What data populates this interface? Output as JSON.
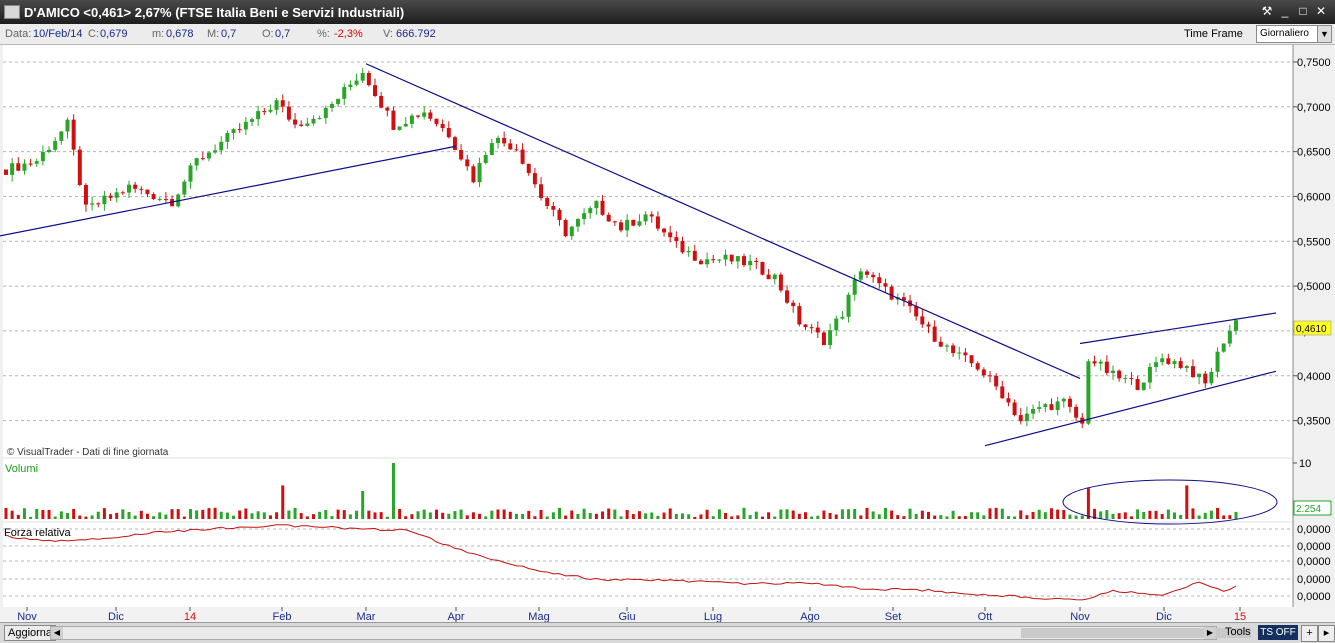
{
  "window": {
    "title": "D'AMICO <0,461> 2,67%  (FTSE Italia Beni e Servizi Industriali)",
    "buttons": {
      "tools": "⚒",
      "minimize": "_",
      "maximize": "□",
      "close": "✕"
    }
  },
  "info": {
    "data_label": "Data:",
    "data_value": "10/Feb/14",
    "c_label": "C:",
    "c_value": "0,679",
    "m_label": "m:",
    "m_value": "0,678",
    "M_label": "M:",
    "M_value": "0,7",
    "o_label": "O:",
    "o_value": "0,7",
    "pct_label": "%:",
    "pct_value": "-2,3%",
    "v_label": "V:",
    "v_value": "666.792",
    "time_frame": "Time Frame",
    "frequency": "Giornaliero"
  },
  "colors": {
    "up": "#2aa52a",
    "down": "#d01010",
    "trend": "#0e0e8c",
    "rsi": "#c41010",
    "grid": "#b4b4b4",
    "price_tag": "#ffff20"
  },
  "chart_data": [
    {
      "type": "candlestick",
      "title": "",
      "watermark": "© VisualTrader - Dati di fine giornata",
      "x_ticks": [
        "Nov",
        "Dic",
        "14",
        "Feb",
        "Mar",
        "Apr",
        "Mag",
        "Giu",
        "Lug",
        "Ago",
        "Set",
        "Ott",
        "Nov",
        "Dic",
        "15"
      ],
      "y_ticks": [
        "0,7500",
        "0,7000",
        "0,6500",
        "0,6000",
        "0,5500",
        "0,5000",
        "0,4500",
        "0,4000",
        "0,3500"
      ],
      "ylim": [
        0.325,
        0.76
      ],
      "last_price": "0,4610",
      "close_points": [
        [
          0,
          0.63
        ],
        [
          5,
          0.64
        ],
        [
          10,
          0.68
        ],
        [
          13,
          0.585
        ],
        [
          20,
          0.61
        ],
        [
          27,
          0.595
        ],
        [
          31,
          0.64
        ],
        [
          37,
          0.67
        ],
        [
          44,
          0.705
        ],
        [
          47,
          0.68
        ],
        [
          52,
          0.695
        ],
        [
          58,
          0.74
        ],
        [
          63,
          0.68
        ],
        [
          68,
          0.695
        ],
        [
          72,
          0.67
        ],
        [
          76,
          0.62
        ],
        [
          79,
          0.665
        ],
        [
          83,
          0.655
        ],
        [
          87,
          0.6
        ],
        [
          91,
          0.56
        ],
        [
          96,
          0.59
        ],
        [
          100,
          0.565
        ],
        [
          104,
          0.58
        ],
        [
          109,
          0.545
        ],
        [
          113,
          0.53
        ],
        [
          117,
          0.53
        ],
        [
          121,
          0.525
        ],
        [
          125,
          0.51
        ],
        [
          129,
          0.46
        ],
        [
          133,
          0.44
        ],
        [
          136,
          0.47
        ],
        [
          139,
          0.52
        ],
        [
          142,
          0.5
        ],
        [
          146,
          0.48
        ],
        [
          150,
          0.45
        ],
        [
          154,
          0.425
        ],
        [
          158,
          0.41
        ],
        [
          162,
          0.38
        ],
        [
          165,
          0.35
        ],
        [
          168,
          0.365
        ],
        [
          172,
          0.37
        ],
        [
          175,
          0.345
        ],
        [
          176,
          0.42
        ],
        [
          180,
          0.4
        ],
        [
          184,
          0.39
        ],
        [
          188,
          0.42
        ],
        [
          192,
          0.41
        ],
        [
          195,
          0.39
        ],
        [
          198,
          0.44
        ],
        [
          200,
          0.461
        ]
      ],
      "trendlines": [
        {
          "from": [
            "start",
            0.556
          ],
          "to": [
            "Apr",
            0.656
          ]
        },
        {
          "from": [
            "Mar",
            0.748
          ],
          "to": [
            "Nov",
            0.397
          ]
        },
        {
          "from": [
            "Ott",
            0.322
          ],
          "to": [
            "end",
            0.405
          ]
        },
        {
          "from": [
            "Nov",
            0.436
          ],
          "to": [
            "end",
            0.47
          ]
        }
      ]
    },
    {
      "type": "bar",
      "title": "Volumi",
      "y_ticks": [
        "10"
      ],
      "last_value": "2.254",
      "spikes": [
        [
          45,
          6
        ],
        [
          58,
          5
        ],
        [
          63,
          10
        ],
        [
          176,
          5.5
        ],
        [
          192,
          6
        ]
      ],
      "base_level": 1.2
    },
    {
      "type": "line",
      "title": "Forza relativa",
      "y_ticks": [
        "0,0000",
        "0,0000",
        "0,0000",
        "0,0000",
        "0,0000"
      ],
      "points": [
        [
          0,
          0.15
        ],
        [
          8,
          0.22
        ],
        [
          15,
          0.18
        ],
        [
          25,
          0.1
        ],
        [
          35,
          0.05
        ],
        [
          45,
          0.02
        ],
        [
          55,
          0.05
        ],
        [
          65,
          0.08
        ],
        [
          75,
          0.35
        ],
        [
          85,
          0.55
        ],
        [
          95,
          0.68
        ],
        [
          110,
          0.7
        ],
        [
          120,
          0.74
        ],
        [
          130,
          0.72
        ],
        [
          140,
          0.8
        ],
        [
          150,
          0.82
        ],
        [
          160,
          0.88
        ],
        [
          170,
          0.92
        ],
        [
          175,
          0.95
        ],
        [
          180,
          0.82
        ],
        [
          188,
          0.88
        ],
        [
          194,
          0.72
        ],
        [
          198,
          0.82
        ],
        [
          200,
          0.78
        ]
      ]
    }
  ],
  "bottom": {
    "refresh": "Aggiorna",
    "tools": "Tools",
    "ts": "TS OFF",
    "plus": "+",
    "arrow": "▸"
  }
}
